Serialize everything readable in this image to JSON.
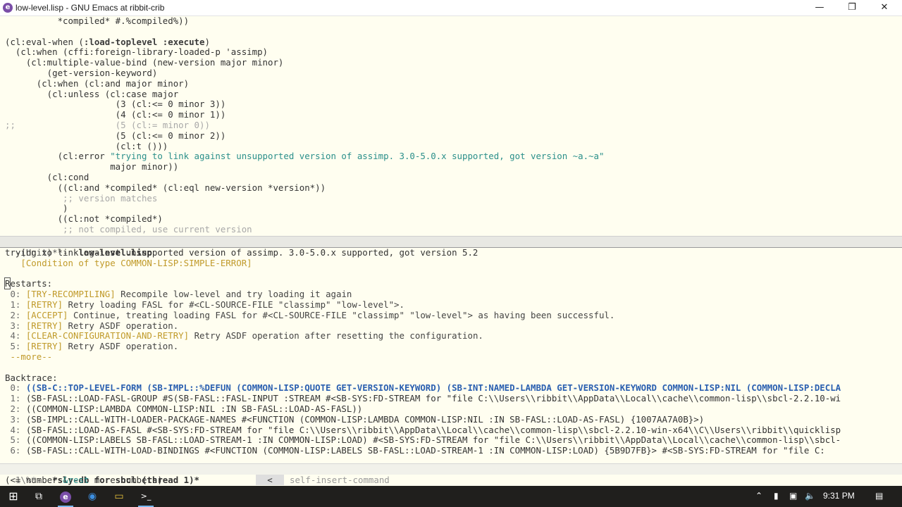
{
  "window": {
    "title": "low-level.lisp - GNU Emacs at ribbit-crib",
    "app_icon_letter": "e",
    "minimize_glyph": "—",
    "maximize_glyph": "❐",
    "close_glyph": "✕"
  },
  "editor": {
    "l1": "          *compiled* #.%compiled%))",
    "l2": "",
    "l3a": "(cl:eval-when (",
    "l3b": ":load-toplevel :execute",
    "l3c": ")",
    "l4": "  (cl:when (cffi:foreign-library-loaded-p 'assimp)",
    "l5": "    (cl:multiple-value-bind (new-version major minor)",
    "l6": "        (get-version-keyword)",
    "l7": "      (cl:when (cl:and major minor)",
    "l8": "        (cl:unless (cl:case major",
    "l9": "                     (3 (cl:<= 0 minor 3))",
    "l10": "                     (4 (cl:<= 0 minor 1))",
    "l11a": ";;",
    "l11b": "                   (5 (cl:= minor 0))",
    "l12": "                     (5 (cl:<= 0 minor 2))",
    "l13": "                     (cl:t ()))",
    "l14a": "          (cl:error ",
    "l14b": "\"trying to link against unsupported version of assimp. 3.0-5.0.x supported, got version ~a.~a\"",
    "l15": "                    major minor))",
    "l16": "        (cl:cond",
    "l17": "          ((cl:and *compiled* (cl:eql new-version *version*))",
    "l18": "           ;; version matches",
    "l19": "           )",
    "l20": "          ((cl:not *compiled*)",
    "l21": "           ;; not compiled, use current version"
  },
  "modeline_top": {
    "prefix": "-(Unix)**-  ",
    "buffer": "low-level.lisp"
  },
  "debugger": {
    "error_msg": "trying to link against unsupported version of assimp. 3.0-5.0.x supported, got version 5.2",
    "condition": "   [Condition of type COMMON-LISP:SIMPLE-ERROR]",
    "restarts_cursor": "R",
    "restarts_rest": "estarts:",
    "restarts": [
      {
        "idx": " 0: ",
        "tag": "[TRY-RECOMPILING]",
        "text": " Recompile low-level and try loading it again"
      },
      {
        "idx": " 1: ",
        "tag": "[RETRY]",
        "text": " Retry loading FASL for #<CL-SOURCE-FILE \"classimp\" \"low-level\">."
      },
      {
        "idx": " 2: ",
        "tag": "[ACCEPT]",
        "text": " Continue, treating loading FASL for #<CL-SOURCE-FILE \"classimp\" \"low-level\"> as having been successful."
      },
      {
        "idx": " 3: ",
        "tag": "[RETRY]",
        "text": " Retry ASDF operation."
      },
      {
        "idx": " 4: ",
        "tag": "[CLEAR-CONFIGURATION-AND-RETRY]",
        "text": " Retry ASDF operation after resetting the configuration."
      },
      {
        "idx": " 5: ",
        "tag": "[RETRY]",
        "text": " Retry ASDF operation."
      }
    ],
    "more": " --more--",
    "backtrace_label": "Backtrace:",
    "frames": [
      {
        "idx": " 0: ",
        "text": "((SB-C::TOP-LEVEL-FORM (SB-IMPL::%DEFUN (COMMON-LISP:QUOTE GET-VERSION-KEYWORD) (SB-INT:NAMED-LAMBDA GET-VERSION-KEYWORD COMMON-LISP:NIL (COMMON-LISP:DECLA"
      },
      {
        "idx": " 1: ",
        "text": "(SB-FASL::LOAD-FASL-GROUP #S(SB-FASL::FASL-INPUT :STREAM #<SB-SYS:FD-STREAM for \"file C:\\\\Users\\\\ribbit\\\\AppData\\\\Local\\\\cache\\\\common-lisp\\\\sbcl-2.2.10-wi"
      },
      {
        "idx": " 2: ",
        "text": "((COMMON-LISP:LAMBDA COMMON-LISP:NIL :IN SB-FASL::LOAD-AS-FASL))"
      },
      {
        "idx": " 3: ",
        "text": "(SB-IMPL::CALL-WITH-LOADER-PACKAGE-NAMES #<FUNCTION (COMMON-LISP:LAMBDA COMMON-LISP:NIL :IN SB-FASL::LOAD-AS-FASL) {1007AA7A0B}>)"
      },
      {
        "idx": " 4: ",
        "text": "(SB-FASL::LOAD-AS-FASL #<SB-SYS:FD-STREAM for \"file C:\\\\Users\\\\ribbit\\\\AppData\\\\Local\\\\cache\\\\common-lisp\\\\sbcl-2.2.10-win-x64\\\\C\\\\Users\\\\ribbit\\\\quicklisp"
      },
      {
        "idx": " 5: ",
        "text": "((COMMON-LISP:LABELS SB-FASL::LOAD-STREAM-1 :IN COMMON-LISP:LOAD) #<SB-SYS:FD-STREAM for \"file C:\\\\Users\\\\ribbit\\\\AppData\\\\Local\\\\cache\\\\common-lisp\\\\sbcl-"
      },
      {
        "idx": " 6: ",
        "text": "(SB-FASL::CALL-WITH-LOAD-BINDINGS #<FUNCTION (COMMON-LISP:LABELS SB-FASL::LOAD-STREAM-1 :IN COMMON-LISP:LOAD) {5B9D7FB}> #<SB-SYS:FD-STREAM for \"file C:"
      }
    ]
  },
  "modeline_bottom": {
    "prefix": "1\\%*-  ",
    "buffer": "*sly-db for sbcl (thread 1)*",
    "arrow": "<",
    "command": "self-insert-command"
  },
  "echo": {
    "a": "(<= number ",
    "b": "&rest",
    "c": " more-numbers)"
  },
  "taskbar": {
    "time": "9:31 PM",
    "start_glyph": "⊞",
    "taskview_glyph": "⧉",
    "emacs_glyph": "e",
    "firefox_glyph": "◉",
    "explorer_glyph": "▭",
    "terminal_glyph": ">_",
    "chevron_glyph": "⌃",
    "usb_glyph": "▮",
    "network_glyph": "▣",
    "volume_glyph": "🔈",
    "notify_glyph": "▤"
  }
}
